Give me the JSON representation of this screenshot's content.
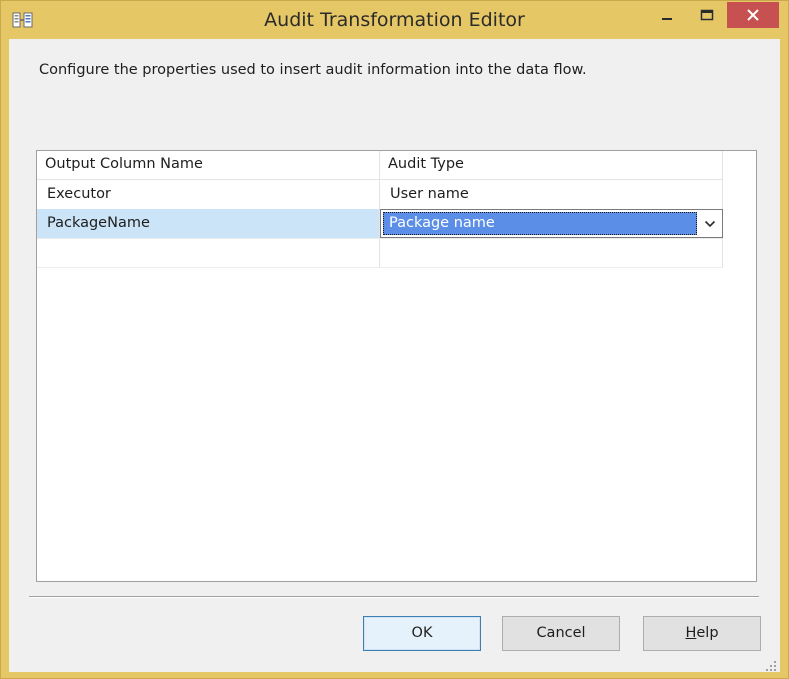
{
  "window": {
    "title": "Audit Transformation Editor",
    "icon": "ssis-transform-icon"
  },
  "description": "Configure the properties used to insert audit information into the data flow.",
  "grid": {
    "columns": [
      "Output Column Name",
      "Audit Type"
    ],
    "rows": [
      {
        "output_column": "Executor",
        "audit_type": "User name"
      },
      {
        "output_column": "PackageName",
        "audit_type": "Package name"
      }
    ],
    "selected_row": 1
  },
  "buttons": {
    "ok": "OK",
    "cancel": "Cancel",
    "help_prefix": "H",
    "help_rest": "elp"
  },
  "colors": {
    "titlebar": "#e6c766",
    "close_button": "#c75050",
    "selection": "#5b8ee6",
    "row_highlight": "#cce4f7"
  }
}
